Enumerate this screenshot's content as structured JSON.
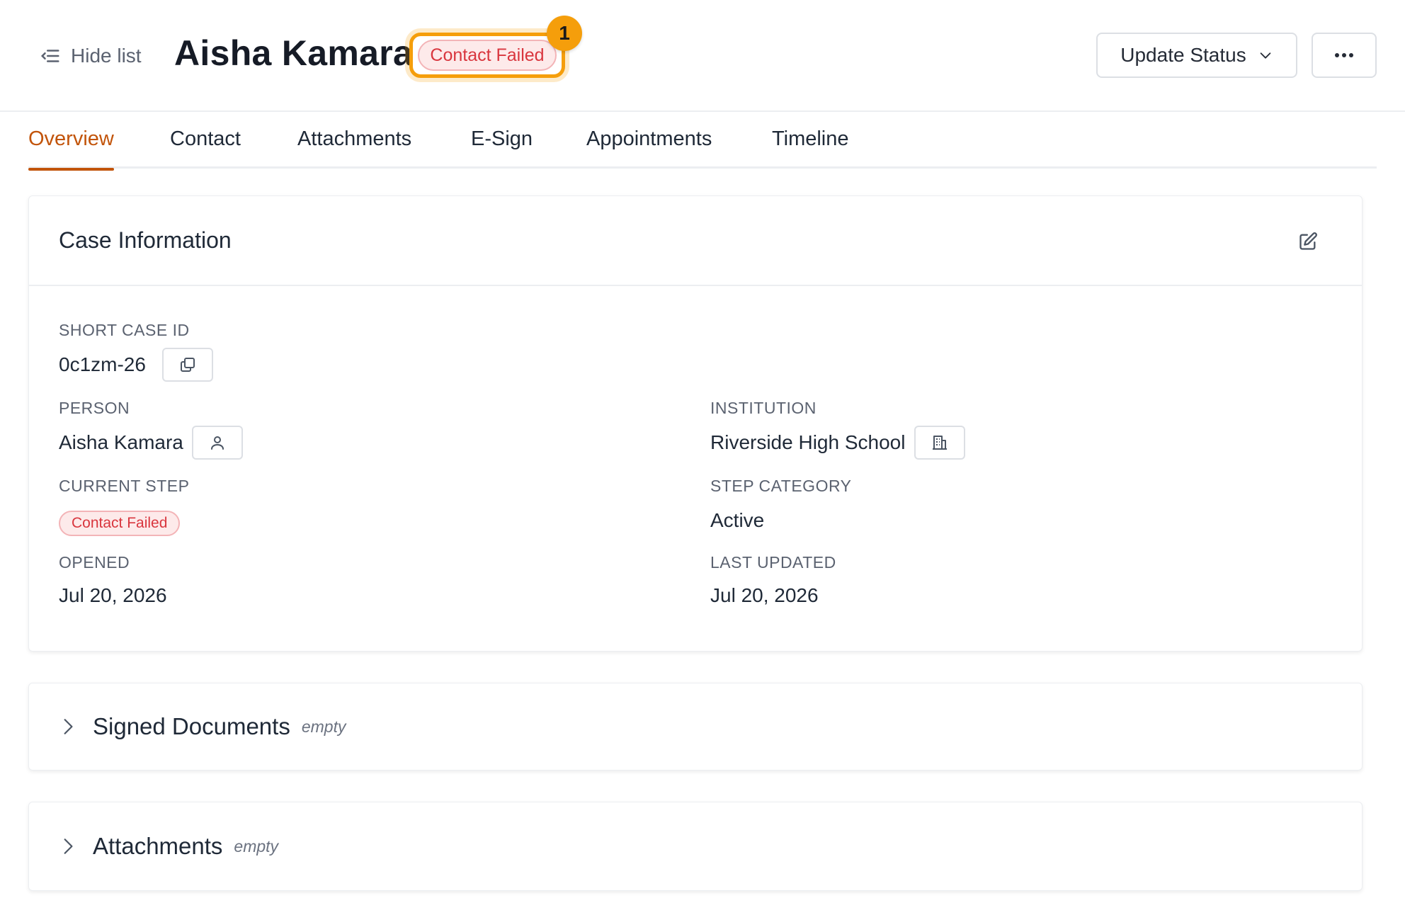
{
  "header": {
    "hide_list_label": "Hide list",
    "person_name": "Aisha Kamara",
    "status_label": "Contact Failed",
    "annotation_number": "1",
    "update_status_label": "Update Status"
  },
  "tabs": [
    {
      "label": "Overview",
      "active": true
    },
    {
      "label": "Contact",
      "active": false
    },
    {
      "label": "Attachments",
      "active": false
    },
    {
      "label": "E-Sign",
      "active": false
    },
    {
      "label": "Appointments",
      "active": false
    },
    {
      "label": "Timeline",
      "active": false
    }
  ],
  "case_info": {
    "title": "Case Information",
    "short_case_id_label": "SHORT CASE ID",
    "short_case_id": "0c1zm-26",
    "person_label": "PERSON",
    "person": "Aisha Kamara",
    "institution_label": "INSTITUTION",
    "institution": "Riverside High School",
    "current_step_label": "CURRENT STEP",
    "current_step": "Contact Failed",
    "step_category_label": "STEP CATEGORY",
    "step_category": "Active",
    "opened_label": "OPENED",
    "opened": "Jul 20, 2026",
    "last_updated_label": "LAST UPDATED",
    "last_updated": "Jul 20, 2026"
  },
  "sections": {
    "signed_documents": {
      "title": "Signed Documents",
      "state": "empty"
    },
    "attachments": {
      "title": "Attachments",
      "state": "empty"
    }
  },
  "colors": {
    "accent": "#c2540a",
    "highlight": "#f59e0b",
    "status_red": "#d9363e",
    "status_red_bg": "#fdeaea"
  },
  "icons": {
    "hide_list": "list-collapse-icon",
    "dropdown": "chevron-down-icon",
    "more": "ellipsis-icon",
    "edit": "edit-icon",
    "copy": "copy-icon",
    "person": "user-icon",
    "institution": "building-icon",
    "expand": "chevron-right-icon"
  }
}
